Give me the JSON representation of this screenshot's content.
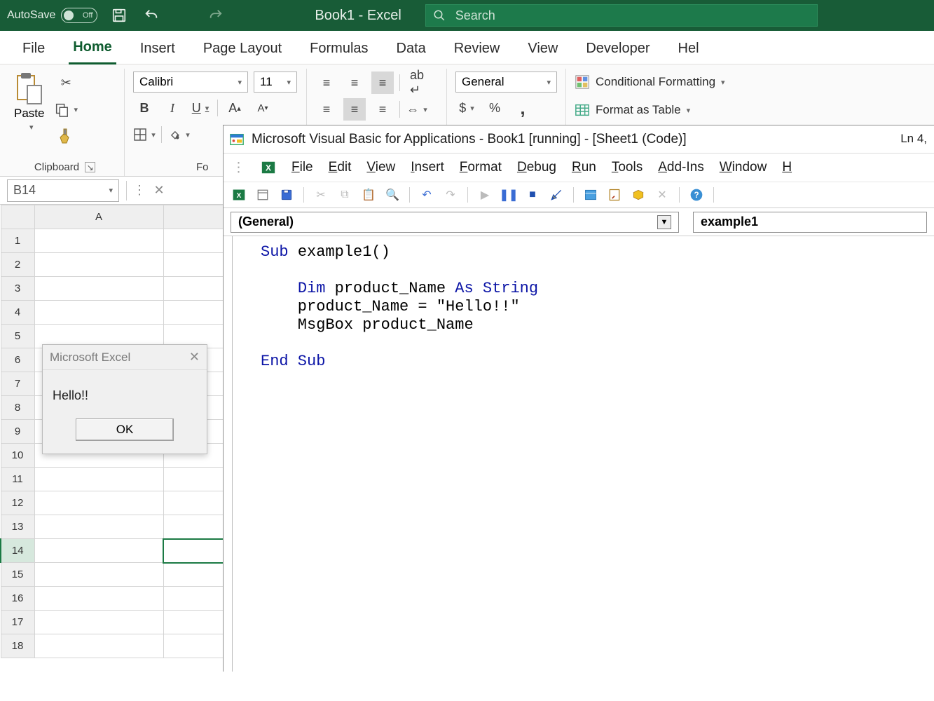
{
  "titlebar": {
    "autosave_label": "AutoSave",
    "autosave_state": "Off",
    "title": "Book1 - Excel",
    "search_placeholder": "Search"
  },
  "ribbon_tabs": [
    "File",
    "Home",
    "Insert",
    "Page Layout",
    "Formulas",
    "Data",
    "Review",
    "View",
    "Developer",
    "Hel"
  ],
  "ribbon_active_tab": "Home",
  "font": {
    "name": "Calibri",
    "size": "11"
  },
  "number_format": "General",
  "group_labels": {
    "clipboard": "Clipboard",
    "font_prefix": "Fo"
  },
  "paste_label": "Paste",
  "styles": {
    "cond": "Conditional Formatting",
    "table": "Format as Table"
  },
  "name_box": "B14",
  "columns": [
    "A"
  ],
  "rows": [
    "1",
    "2",
    "3",
    "4",
    "5",
    "6",
    "7",
    "8",
    "9",
    "10",
    "11",
    "12",
    "13",
    "14",
    "15",
    "16",
    "17",
    "18"
  ],
  "selected_row": "14",
  "msgbox": {
    "title": "Microsoft Excel",
    "body": "Hello!!",
    "ok": "OK"
  },
  "vba": {
    "title": "Microsoft Visual Basic for Applications - Book1 [running] - [Sheet1 (Code)]",
    "menu": [
      "File",
      "Edit",
      "View",
      "Insert",
      "Format",
      "Debug",
      "Run",
      "Tools",
      "Add-Ins",
      "Window",
      "H"
    ],
    "object_dd": "(General)",
    "proc_dd": "example1",
    "line_col": "Ln 4,",
    "code_lines": [
      {
        "indent": 0,
        "tokens": [
          {
            "t": "Sub ",
            "k": true
          },
          {
            "t": "example1()"
          }
        ]
      },
      {
        "indent": 0,
        "tokens": [
          {
            "t": " "
          }
        ]
      },
      {
        "indent": 1,
        "tokens": [
          {
            "t": "Dim ",
            "k": true
          },
          {
            "t": "product_Name "
          },
          {
            "t": "As String",
            "k": true
          }
        ]
      },
      {
        "indent": 1,
        "tokens": [
          {
            "t": "product_Name = \"Hello!!\""
          }
        ]
      },
      {
        "indent": 1,
        "tokens": [
          {
            "t": "MsgBox product_Name"
          }
        ]
      },
      {
        "indent": 0,
        "tokens": [
          {
            "t": " "
          }
        ]
      },
      {
        "indent": 0,
        "tokens": [
          {
            "t": "End Sub",
            "k": true
          }
        ]
      }
    ]
  }
}
